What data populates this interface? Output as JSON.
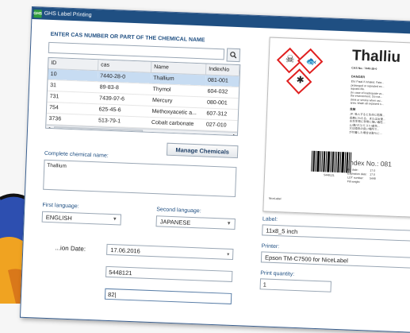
{
  "window": {
    "title": "GHS Label Printing",
    "app_icon": "GHS"
  },
  "search": {
    "title": "ENTER CAS NUMBER OR PART OF THE CHEMICAL NAME",
    "value": "",
    "button_icon": "search-icon"
  },
  "grid": {
    "columns": [
      "ID",
      "cas",
      "Name",
      "IndexNo"
    ],
    "rows": [
      [
        "10",
        "7440-28-0",
        "Thallium",
        "081-001"
      ],
      [
        "31",
        "89-83-8",
        "Thymol",
        "604-032"
      ],
      [
        "731",
        "7439-97-6",
        "Mercury",
        "080-001"
      ],
      [
        "754",
        "625-45-6",
        "Methoxyacetic a...",
        "607-312"
      ],
      [
        "3736",
        "513-79-1",
        "Cobalt carbonate",
        "027-010"
      ]
    ],
    "selected_row": 0,
    "scroll_thumb": "III"
  },
  "manage_button": "Manage Chemicals",
  "complete_name": {
    "label": "Complete chemical name:",
    "value": "Thallium"
  },
  "first_language": {
    "label": "First language:",
    "value": "ENGLISH"
  },
  "second_language": {
    "label": "Second language:",
    "value": "JAPANESE"
  },
  "date": {
    "label": "...ion Date:",
    "value": "17.06.2016"
  },
  "lot": {
    "value": "5448121"
  },
  "weight": {
    "value": "82|"
  },
  "label_field": {
    "label": "Label:",
    "value": "11x8_5 inch"
  },
  "printer": {
    "label": "Printer:",
    "value": "Epson TM-C7500 for NiceLabel"
  },
  "quantity": {
    "label": "Print quantity:",
    "value": "1"
  },
  "preview": {
    "title": "Thalliu",
    "cas": "CAS No.: 7440-28-0",
    "signal": "DANGER",
    "hazard_text": [
      "EN: Fatal if inhaled. Fata...",
      "prolonged or repeated ex...",
      "aquatic life.",
      "(In case of inadequate ve...",
      "the environment. Do not...",
      "drink or smoke when usi...",
      "area. Wash all exposed s..."
    ],
    "jp_head": "危険",
    "jp_text": [
      "JP: 吸入すると生命に危険...",
      "長期にわたる、または反復...",
      "水生生物に非常に強い毒性...",
      "ん/霧/ガス/ミスト/蒸気...",
      "又は換気の良い場所で...",
      "が付着した場合は直ちに..."
    ],
    "barcode_number": "5448121",
    "index_label": "Index No.: 081",
    "fill_date_label": "Fill date:",
    "fill_date_value": "17.0",
    "exp_label": "Expiration date:",
    "exp_value": "17.0",
    "lot_label": "LOT number:",
    "lot_value": "5448",
    "weight_label": "Fill weight:",
    "footer": "NiceLabel",
    "pictograms": [
      "skull-crossbones-icon",
      "environment-icon",
      "health-hazard-icon"
    ]
  },
  "colors": {
    "titlebar": "#1f4f82",
    "accent": "#1f4f82",
    "selection": "#c7dcf2",
    "ghs_red": "#e02020"
  }
}
